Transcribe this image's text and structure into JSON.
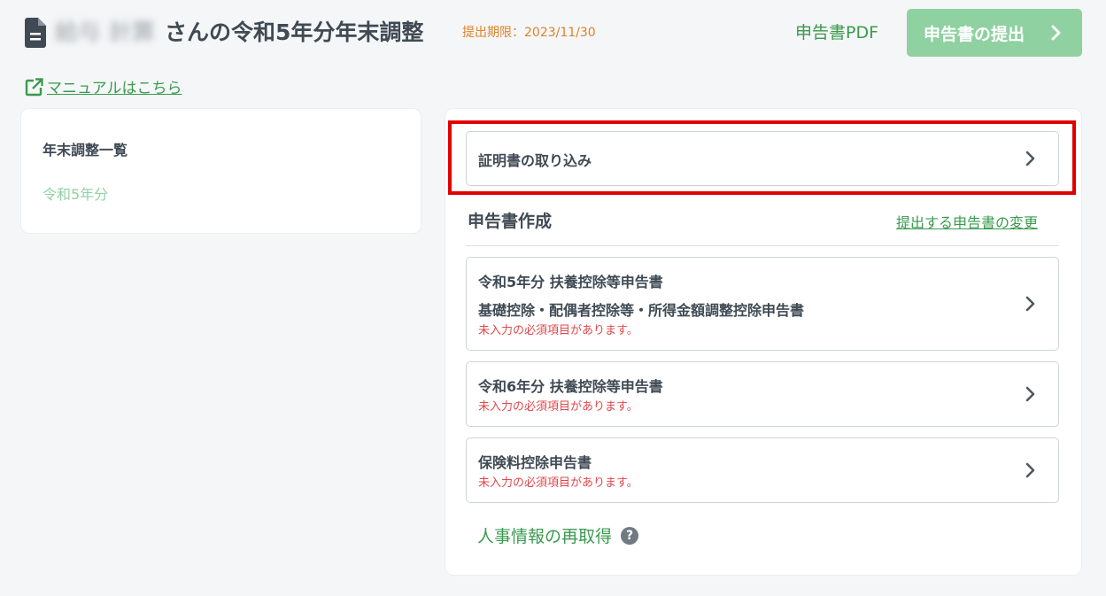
{
  "header": {
    "user_name": "給与 計算",
    "title": "さんの令和5年分年末調整",
    "deadline": "提出期限：2023/11/30",
    "pdf_label": "申告書PDF",
    "submit_label": "申告書の提出"
  },
  "manual_link": "マニュアルはこちら",
  "sidebar": {
    "title": "年末調整一覧",
    "items": [
      "令和5年分"
    ]
  },
  "main": {
    "import_label": "証明書の取り込み",
    "section_title": "申告書作成",
    "change_link": "提出する申告書の変更",
    "forms": [
      {
        "line1": "令和5年分 扶養控除等申告書",
        "line2": "基礎控除・配偶者控除等・所得金額調整控除申告書",
        "warning": "未入力の必須項目があります。"
      },
      {
        "line1": "令和6年分 扶養控除等申告書",
        "warning": "未入力の必須項目があります。"
      },
      {
        "line1": "保険料控除申告書",
        "warning": "未入力の必須項目があります。"
      }
    ],
    "refetch_label": "人事情報の再取得",
    "help_glyph": "?"
  },
  "colors": {
    "accent_green": "#3a9a4f",
    "button_green": "#8fd1a1",
    "deadline_orange": "#e0822c",
    "warning_red": "#e0474a",
    "highlight_red": "#e00000"
  },
  "icons": [
    "document-icon",
    "chevron-right-icon",
    "external-link-icon",
    "help-icon"
  ]
}
